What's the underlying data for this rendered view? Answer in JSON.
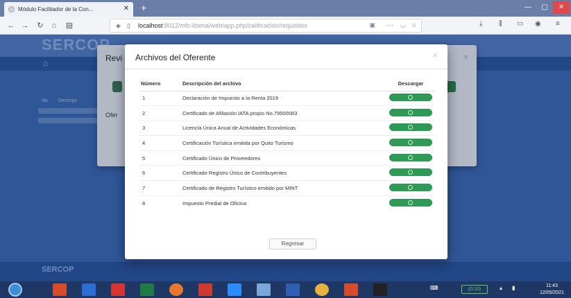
{
  "browser": {
    "tab_title": "Módulo Facilitador de la Con...",
    "url_host": "localhost",
    "url_path": ":8012/mfc-liberia/web/app.php/calificacion/requisitos",
    "url_more": "···"
  },
  "page_bg": {
    "logo": "SERCOP",
    "label_no": "No.",
    "label_desc": "Descripc",
    "footer_logo": "SERCOP"
  },
  "back_modal": {
    "title": "Revi",
    "ofer_label": "Ofer"
  },
  "modal": {
    "title": "Archivos del Oferente",
    "columns": {
      "numero": "Número",
      "descripcion": "Descripción del archivo",
      "descargar": "Descargar"
    },
    "rows": [
      {
        "numero": "1",
        "descripcion": "Declaración de Impuesto a la Renta 2019"
      },
      {
        "numero": "2",
        "descripcion": "Certificado de Afiliación IATA propio No.79500083"
      },
      {
        "numero": "3",
        "descripcion": "Licencia Única Anual de Actividades Económicas"
      },
      {
        "numero": "4",
        "descripcion": "Certificación Turística emitida por Quito Turismo"
      },
      {
        "numero": "5",
        "descripcion": "Certificado Único de Proveedores"
      },
      {
        "numero": "6",
        "descripcion": "Certificado Registro Único de Contribuyentes"
      },
      {
        "numero": "7",
        "descripcion": "Certificado de Registro Turístico emitido por MINT"
      },
      {
        "numero": "8",
        "descripcion": "Impuesto Predial de Oficina"
      }
    ],
    "regresar_label": "Regresar"
  },
  "taskbar": {
    "battery": "(0:10)",
    "time": "11:43",
    "date": "12/05/2021"
  },
  "colors": {
    "download_button": "#2f9a55",
    "page_background": "#3f6fbd"
  }
}
